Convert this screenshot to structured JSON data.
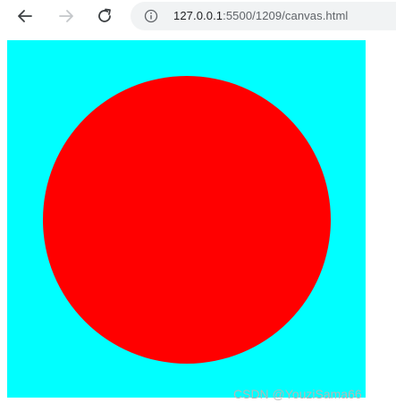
{
  "browser": {
    "url": {
      "host": "127.0.0.1",
      "rest": ":5500/1209/canvas.html"
    },
    "icons": {
      "back": "arrow-left-icon",
      "forward": "arrow-right-icon",
      "reload": "reload-icon",
      "site_info": "info-icon"
    },
    "forward_enabled": false
  },
  "canvas": {
    "background_color": "#00ffff",
    "shapes": [
      {
        "type": "circle",
        "fill": "#ff0000"
      }
    ]
  },
  "watermark": {
    "text": "CSDN @YouziSama66"
  }
}
